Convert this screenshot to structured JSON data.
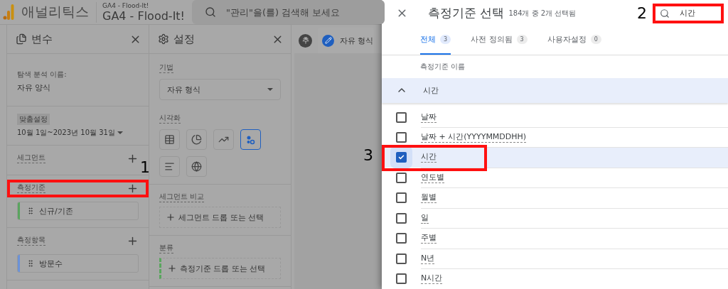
{
  "app_header": {
    "product": "애널리틱스",
    "property_small": "GA4 - Flood-It!",
    "property": "GA4 - Flood-It!",
    "search": {
      "placeholder": "\"관리\"을(를) 검색해 보세요"
    }
  },
  "variables_panel": {
    "title": "변수",
    "name_label": "탐색 분석 이름:",
    "name_value": "자유 양식",
    "date_badge": "맞춤설정",
    "date_range": "10월 1일~2023년 10월 31일",
    "sections": [
      {
        "label": "세그먼트"
      },
      {
        "label": "측정기준",
        "callout": "1",
        "chips": [
          {
            "label": "신규/기존",
            "color": "#5aa55e"
          }
        ]
      },
      {
        "label": "측정항목",
        "chips": [
          {
            "label": "방문수",
            "color": "#6b92d8"
          }
        ]
      }
    ]
  },
  "settings_panel": {
    "title": "설정",
    "technique_label": "기법",
    "technique_value": "자유 형식",
    "visualization_label": "시각화",
    "visualizations": [
      {
        "kind": "table",
        "selected": false
      },
      {
        "kind": "donut",
        "selected": false
      },
      {
        "kind": "line",
        "selected": false
      },
      {
        "kind": "scatter",
        "selected": true
      },
      {
        "kind": "bar",
        "selected": false
      },
      {
        "kind": "geo",
        "selected": false
      }
    ],
    "drops": [
      {
        "label": "세그먼트 비교",
        "placeholder": "세그먼트 드롭 또는 선택"
      },
      {
        "label": "분류",
        "placeholder": "측정기준 드롭 또는 선택",
        "color": "#5aa55e"
      }
    ]
  },
  "canvas_tabs": [
    {
      "kind": "add",
      "label": "추"
    },
    {
      "kind": "edit",
      "label": "자유 형식"
    }
  ],
  "drawer": {
    "title": "측정기준 선택",
    "subtitle": "184개 중 2개 선택됨",
    "search": {
      "value": "시간",
      "callout": "2"
    },
    "tabs": [
      {
        "label": "전체",
        "count": "3",
        "selected": true
      },
      {
        "label": "사전 정의됨",
        "count": "3",
        "selected": false
      },
      {
        "label": "사용자설정",
        "count": "0",
        "selected": false
      }
    ],
    "column_header": "측정기준 이름",
    "group": {
      "label": "시간",
      "expanded": true
    },
    "items": [
      {
        "label": "날짜",
        "checked": false
      },
      {
        "label": "날짜 + 시간(YYYYMMDDHH)",
        "checked": false
      },
      {
        "label": "시간",
        "checked": true,
        "callout": "3"
      },
      {
        "label": "연도별",
        "checked": false
      },
      {
        "label": "월별",
        "checked": false
      },
      {
        "label": "일",
        "checked": false
      },
      {
        "label": "주별",
        "checked": false
      },
      {
        "label": "N년",
        "checked": false
      },
      {
        "label": "N시간",
        "checked": false
      }
    ]
  }
}
